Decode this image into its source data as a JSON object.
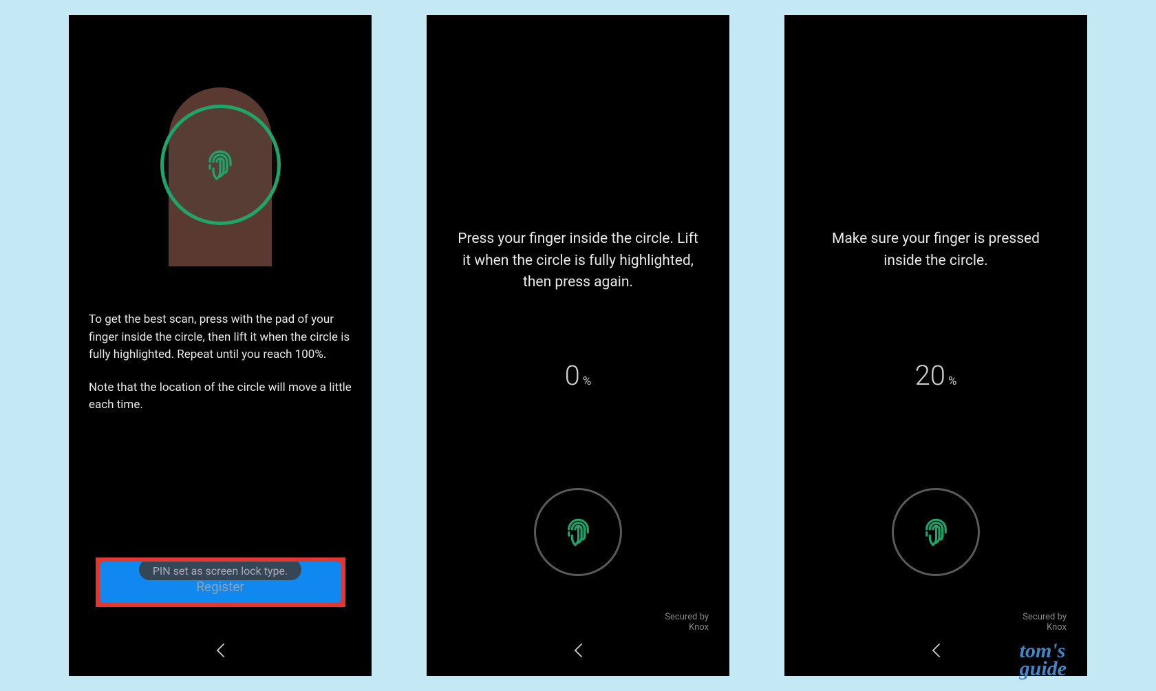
{
  "screens": [
    {
      "instructions_p1": "To get the best scan, press with the pad of your finger inside the circle, then lift it when the circle is fully highlighted. Repeat until you reach 100%.",
      "instructions_p2": "Note that the location of the circle will move a little each time.",
      "toast": "PIN set as screen lock type.",
      "button_label": "Register"
    },
    {
      "message": "Press your finger inside the circle. Lift it when the circle is fully highlighted, then press again.",
      "progress_value": "0",
      "progress_unit": "%",
      "secured_line1": "Secured by",
      "secured_line2": "Knox"
    },
    {
      "message": "Make sure your finger is pressed inside the circle.",
      "progress_value": "20",
      "progress_unit": "%",
      "secured_line1": "Secured by",
      "secured_line2": "Knox"
    }
  ],
  "watermark_line1": "tom's",
  "watermark_line2": "guide",
  "colors": {
    "accent_green": "#1fa56a",
    "highlight_red": "#e2362f",
    "button_blue": "#1088f0",
    "page_bg": "#c5e8f5"
  }
}
